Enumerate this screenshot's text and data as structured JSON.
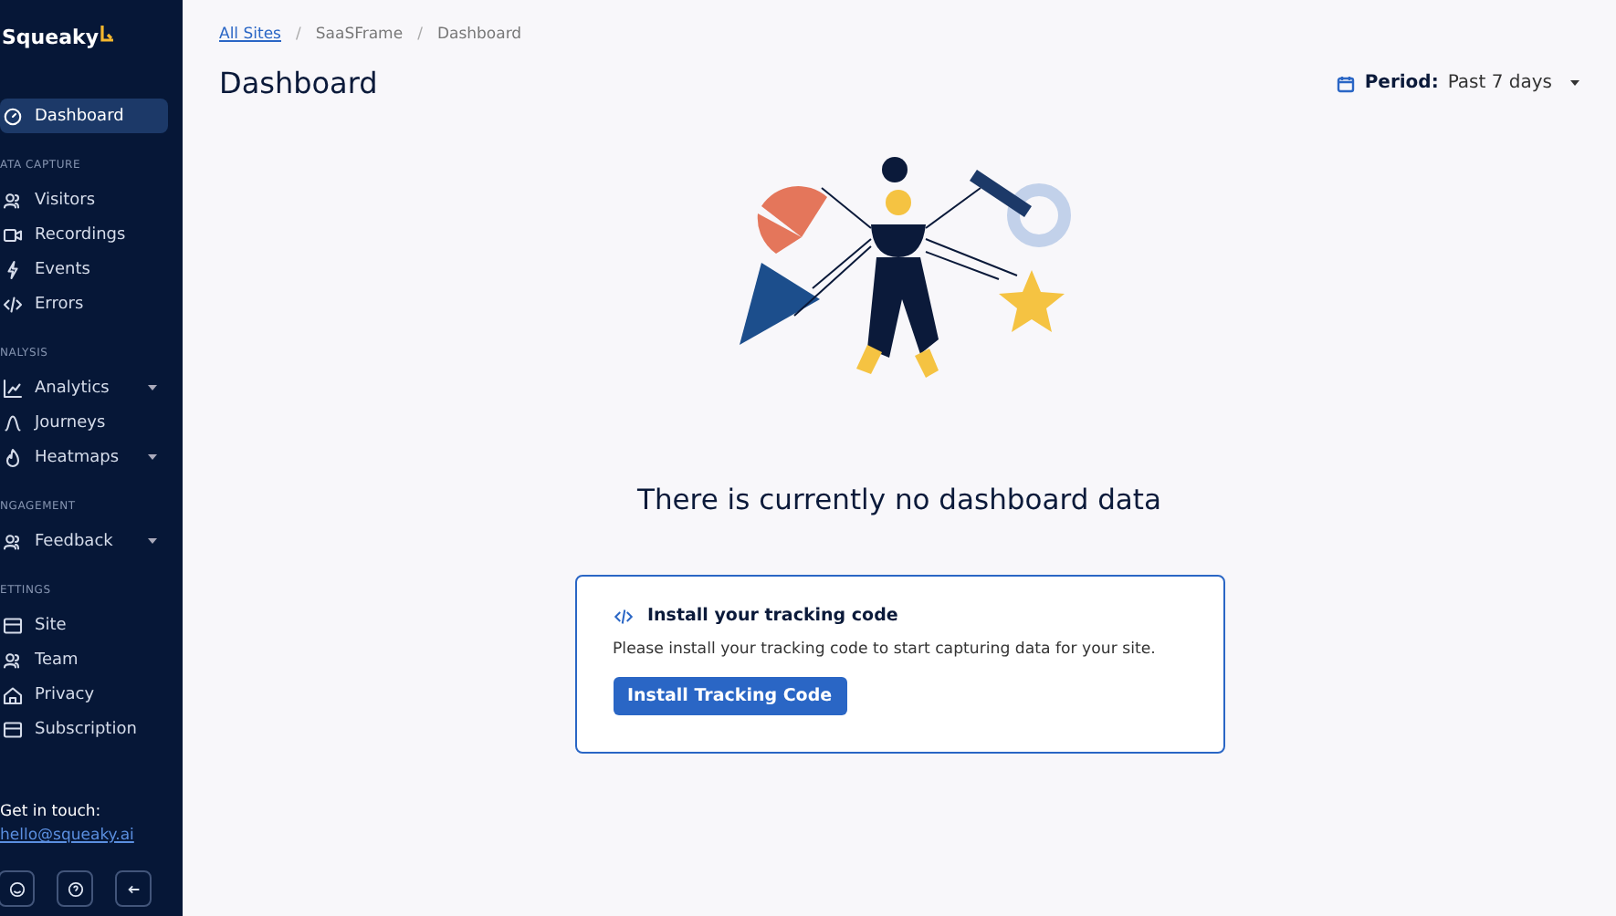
{
  "sidebar": {
    "logo": "Squeaky",
    "sections": [
      {
        "items": [
          {
            "label": "Dashboard",
            "selected": true,
            "expandable": false
          }
        ]
      },
      {
        "heading": "ATA CAPTURE",
        "items": [
          {
            "label": "Visitors",
            "selected": false,
            "expandable": false
          },
          {
            "label": "Recordings",
            "selected": false,
            "expandable": false
          },
          {
            "label": "Events",
            "selected": false,
            "expandable": false
          },
          {
            "label": "Errors",
            "selected": false,
            "expandable": false
          }
        ]
      },
      {
        "heading": "NALYSIS",
        "items": [
          {
            "label": "Analytics",
            "selected": false,
            "expandable": true
          },
          {
            "label": "Journeys",
            "selected": false,
            "expandable": false
          },
          {
            "label": "Heatmaps",
            "selected": false,
            "expandable": true
          }
        ]
      },
      {
        "heading": "NGAGEMENT",
        "items": [
          {
            "label": "Feedback",
            "selected": false,
            "expandable": true
          }
        ]
      },
      {
        "heading": "ETTINGS",
        "items": [
          {
            "label": "Site",
            "selected": false,
            "expandable": false
          },
          {
            "label": "Team",
            "selected": false,
            "expandable": false
          },
          {
            "label": "Privacy",
            "selected": false,
            "expandable": false
          },
          {
            "label": "Subscription",
            "selected": false,
            "expandable": false
          }
        ]
      }
    ],
    "contact_label": "Get in touch:",
    "contact_email": "hello@squeaky.ai"
  },
  "breadcrumbs": [
    {
      "label": "All Sites",
      "link": true
    },
    {
      "separator": "/",
      "label": "SaaSFrame",
      "link": false
    },
    {
      "separator": "/",
      "label": "Dashboard",
      "link": false
    }
  ],
  "page_title": "Dashboard",
  "period": {
    "label": "Period:",
    "value": "Past 7 days"
  },
  "empty_state": {
    "message": "There is currently no dashboard data"
  },
  "tracking_card": {
    "title": "Install your tracking code",
    "text": "Please install your tracking code to start capturing data for your site.",
    "button": "Install Tracking Code"
  }
}
